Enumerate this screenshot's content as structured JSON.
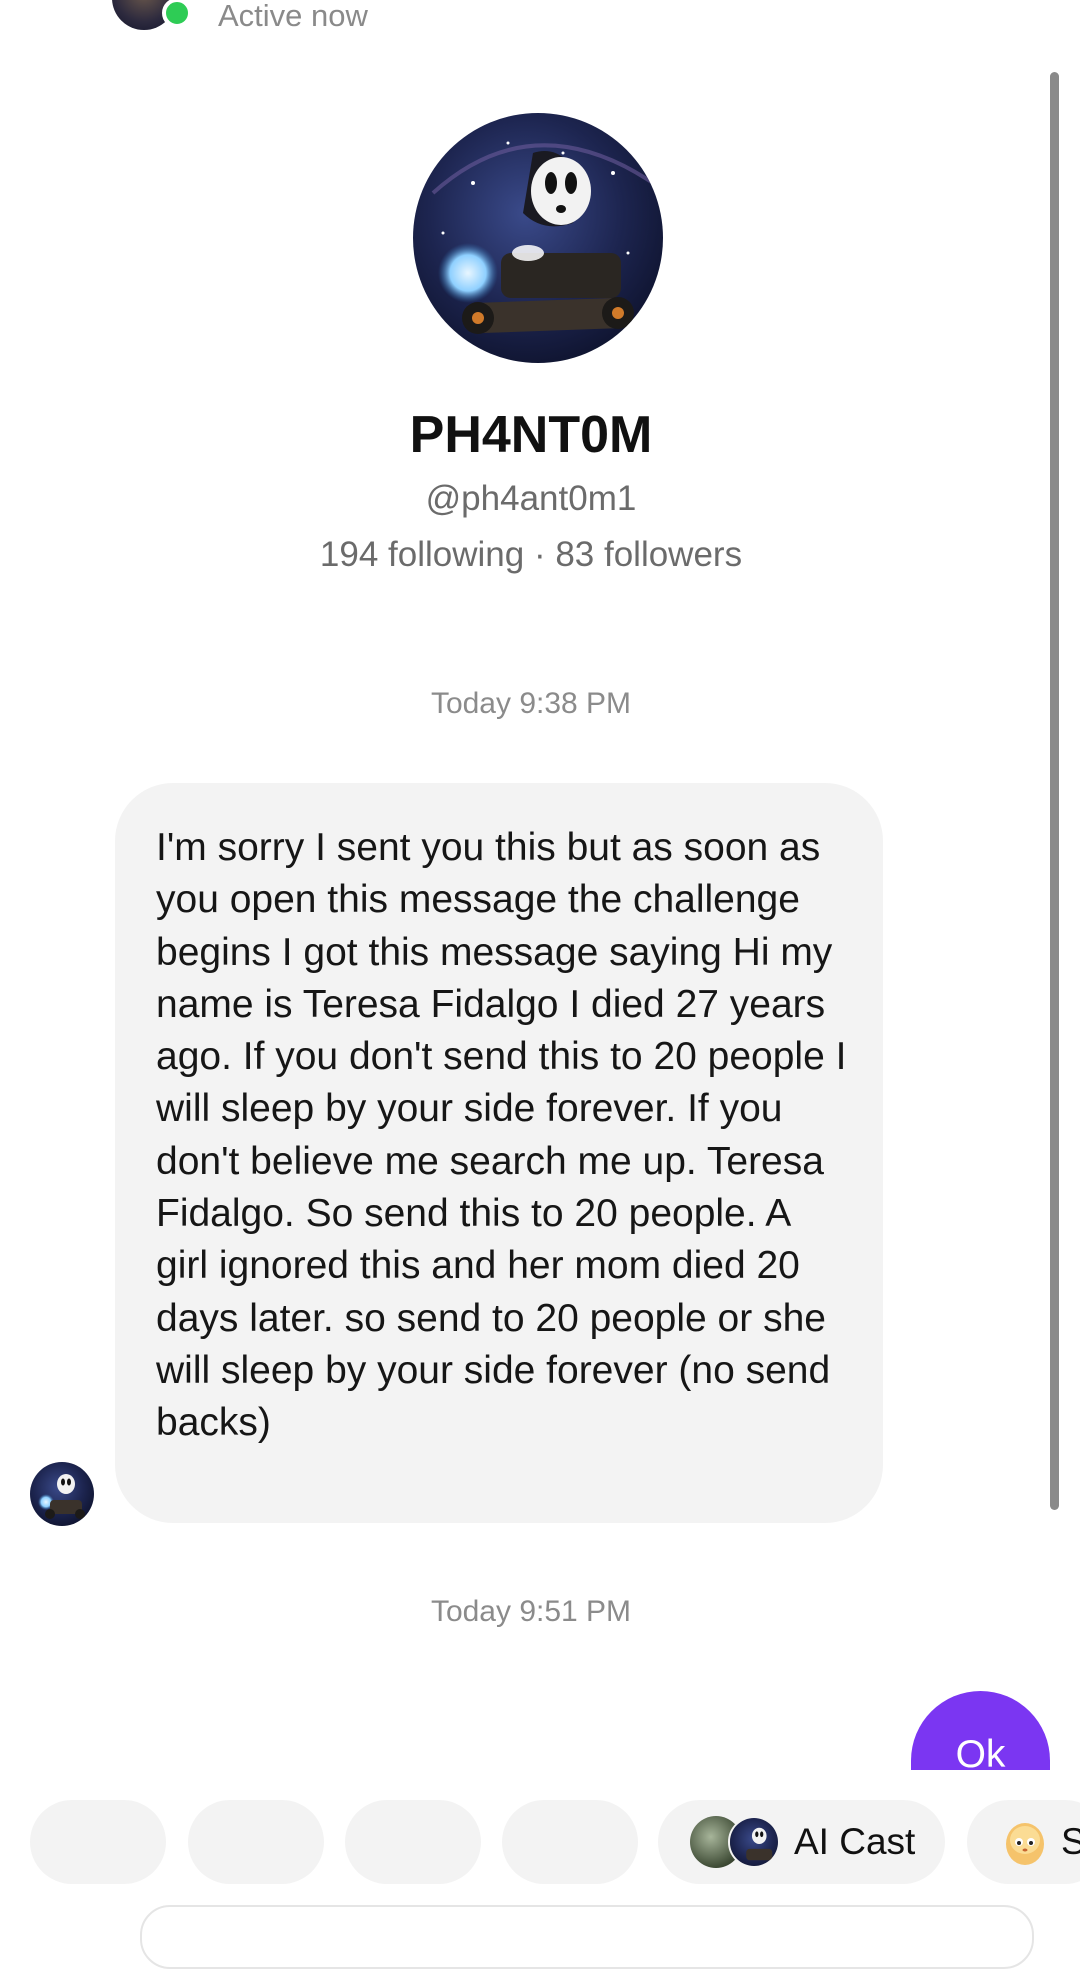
{
  "header": {
    "status": "Active now",
    "back_icon": "chevron-left-icon",
    "online_color": "#2ecc55"
  },
  "profile": {
    "name": "PH4NT0M",
    "handle": "@ph4ant0m1",
    "stats": "194 following · 83 followers"
  },
  "messages": [
    {
      "timestamp": "Today 9:38 PM",
      "direction": "received",
      "text": "I'm sorry I sent you this but as soon as you open this message the challenge begins I got this message saying Hi my name is Teresa Fidalgo I died 27 years ago. If you don't send this to 20 people I will sleep by your side forever. If you don't believe me search me up. Teresa Fidalgo. So send this to 20 people. A girl ignored this and her mom died 20 days later. so send to 20 people or she will sleep by your side forever (no send backs)"
    },
    {
      "timestamp": "Today 9:51 PM",
      "direction": "sent",
      "text": "Ok"
    }
  ],
  "quick_replies": [
    {
      "label": ""
    },
    {
      "label": ""
    },
    {
      "label": ""
    },
    {
      "label": ""
    },
    {
      "label": "AI Cast",
      "icon": "dual-avatar-icon"
    },
    {
      "label": "S",
      "icon": "egg-face-icon"
    }
  ],
  "colors": {
    "sent_bubble": "#7b36f2",
    "received_bubble": "#f3f3f3",
    "muted_text": "#6b6b6b"
  }
}
